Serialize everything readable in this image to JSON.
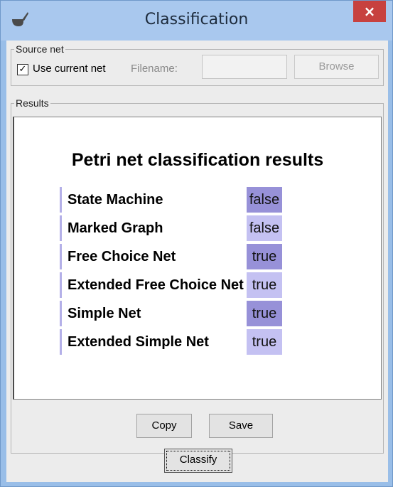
{
  "window": {
    "title": "Classification",
    "close_glyph": "×",
    "app_icon": "pipe-icon"
  },
  "source": {
    "legend": "Source net",
    "use_current_checked": true,
    "use_current_label": "Use current net",
    "filename_label": "Filename:",
    "filename_value": "",
    "browse_label": "Browse"
  },
  "results": {
    "legend": "Results",
    "heading": "Petri net classification results",
    "rows": [
      {
        "name": "State Machine",
        "value": "false"
      },
      {
        "name": "Marked Graph",
        "value": "false"
      },
      {
        "name": "Free Choice Net",
        "value": "true"
      },
      {
        "name": "Extended Free Choice Net",
        "value": "true"
      },
      {
        "name": "Simple Net",
        "value": "true"
      },
      {
        "name": "Extended Simple Net",
        "value": "true"
      }
    ],
    "copy_label": "Copy",
    "save_label": "Save"
  },
  "classify_label": "Classify",
  "colors": {
    "titlebar": "#a9c8ee",
    "close_button": "#c7413f",
    "value_dark": "#9791d8",
    "value_light": "#c4c1f2"
  }
}
